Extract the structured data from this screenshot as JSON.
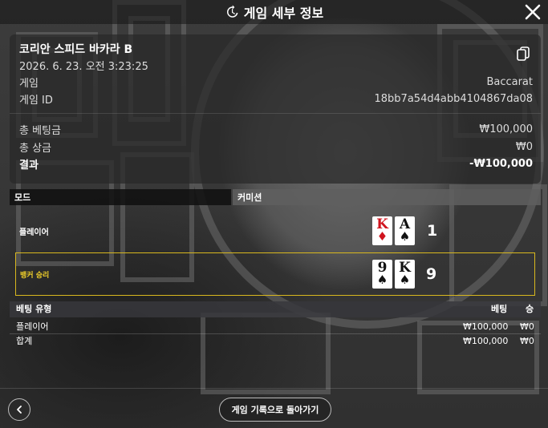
{
  "header": {
    "title": "게임 세부 정보",
    "icons": {
      "history": "history-icon",
      "close": "close-icon"
    }
  },
  "game": {
    "name": "코리안 스피드 바카라 B",
    "datetime": "2026. 6. 23. 오전 3:23:25",
    "game_label": "게임",
    "game_value": "Baccarat",
    "id_label": "게임 ID",
    "id_value": "18bb7a54d4abb4104867da08"
  },
  "summary": {
    "total_bet_label": "총 베팅금",
    "total_bet_value": "₩100,000",
    "total_win_label": "총 상금",
    "total_win_value": "₩0",
    "result_label": "결과",
    "result_value": "-₩100,000"
  },
  "mode_table": {
    "mode_label": "모드",
    "commission_label": "커미션"
  },
  "hands": {
    "player": {
      "label": "플레이어",
      "cards": [
        {
          "rank": "K",
          "suit": "♦",
          "color": "#d0141e"
        },
        {
          "rank": "A",
          "suit": "♠",
          "color": "#111111"
        }
      ],
      "score": "1"
    },
    "banker": {
      "label": "뱅커 승리",
      "label_color": "#f2d12a",
      "cards": [
        {
          "rank": "9",
          "suit": "♠",
          "color": "#111111"
        },
        {
          "rank": "K",
          "suit": "♠",
          "color": "#111111"
        }
      ],
      "score": "9"
    }
  },
  "bets": {
    "headers": {
      "type": "베팅 유형",
      "bet": "베팅",
      "win": "승"
    },
    "rows": [
      {
        "type": "플레이어",
        "bet": "₩100,000",
        "win": "₩0"
      }
    ],
    "total": {
      "type": "합계",
      "bet": "₩100,000",
      "win": "₩0"
    }
  },
  "footer": {
    "back_icon": "chevron-left-icon",
    "history_button": "게임 기록으로 돌아가기"
  },
  "colors": {
    "winner_border": "#d9b81e",
    "text": "#e8e8e8"
  }
}
